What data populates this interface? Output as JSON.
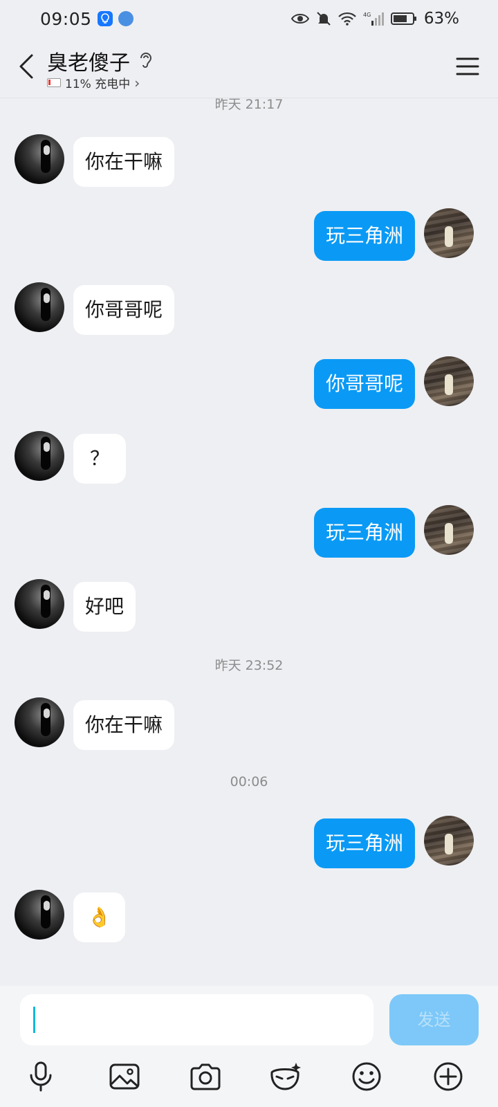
{
  "status_bar": {
    "time": "09:05",
    "battery_percent": "63%",
    "network": "4G"
  },
  "header": {
    "contact_name": "臭老傻子",
    "contact_status": "11% 充电中",
    "chevron": "›"
  },
  "chat": {
    "timestamps": [
      "昨天 21:17",
      "昨天 23:52",
      "00:06"
    ],
    "messages": [
      {
        "side": "left",
        "text": "你在干嘛"
      },
      {
        "side": "right",
        "text": "玩三角洲"
      },
      {
        "side": "left",
        "text": "你哥哥呢"
      },
      {
        "side": "right",
        "text": "你哥哥呢"
      },
      {
        "side": "left",
        "text": "？"
      },
      {
        "side": "right",
        "text": "玩三角洲"
      },
      {
        "side": "left",
        "text": "好吧"
      },
      {
        "side": "left",
        "text": "你在干嘛"
      },
      {
        "side": "right",
        "text": "玩三角洲"
      },
      {
        "side": "left",
        "text": "👌"
      }
    ]
  },
  "input": {
    "value": "",
    "send_label": "发送"
  },
  "toolbar": {
    "icons": [
      "microphone-icon",
      "image-icon",
      "camera-icon",
      "mask-sticker-icon",
      "emoji-icon",
      "plus-icon"
    ]
  },
  "colors": {
    "background": "#eeeff3",
    "bubble_self": "#0a9af5",
    "bubble_other": "#ffffff",
    "send_button": "#7dc8f8"
  }
}
